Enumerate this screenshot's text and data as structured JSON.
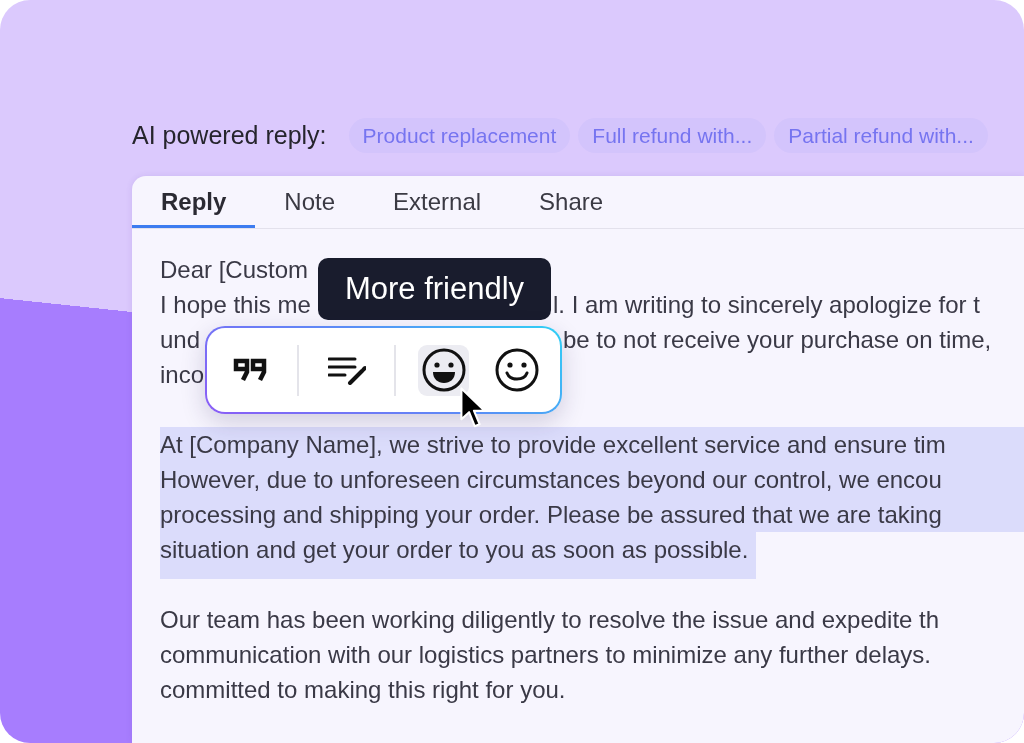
{
  "header": {
    "label": "AI powered reply:",
    "suggestions": [
      "Product replacement",
      "Full refund with...",
      "Partial refund with..."
    ]
  },
  "editor": {
    "tabs": [
      {
        "label": "Reply",
        "selected": true
      },
      {
        "label": "Note",
        "selected": false
      },
      {
        "label": "External",
        "selected": false
      },
      {
        "label": "Share",
        "selected": false
      }
    ],
    "paragraphs": [
      {
        "highlighted": false,
        "lines": [
          [
            "Dear [Custom"
          ],
          [
            "I hope this me",
            "l. I am writing to sincerely apologize for t"
          ],
          [
            "und",
            "be to not receive your purchase on time,"
          ],
          [
            "inco"
          ]
        ]
      },
      {
        "highlighted": true,
        "lines": [
          [
            "At [Company Name], we strive to provide excellent service and ensure tim"
          ],
          [
            "However, due to unforeseen circumstances beyond our control, we encou"
          ],
          [
            "processing and shipping your order. Please be assured that we are taking"
          ],
          [
            "situation and get your order to you as soon as possible."
          ]
        ]
      },
      {
        "highlighted": false,
        "lines": [
          [
            "Our team has been working diligently to resolve the issue and expedite th"
          ],
          [
            "communication with our logistics partners to minimize any further delays."
          ],
          [
            "committed to making this right for you."
          ]
        ]
      }
    ]
  },
  "tooltip": {
    "text": "More friendly"
  },
  "toolbar": {
    "buttons": [
      {
        "kind": "quote",
        "selected": false
      },
      {
        "kind": "edit",
        "selected": false
      },
      {
        "kind": "grin",
        "selected": true
      },
      {
        "kind": "smile",
        "selected": false
      }
    ]
  }
}
